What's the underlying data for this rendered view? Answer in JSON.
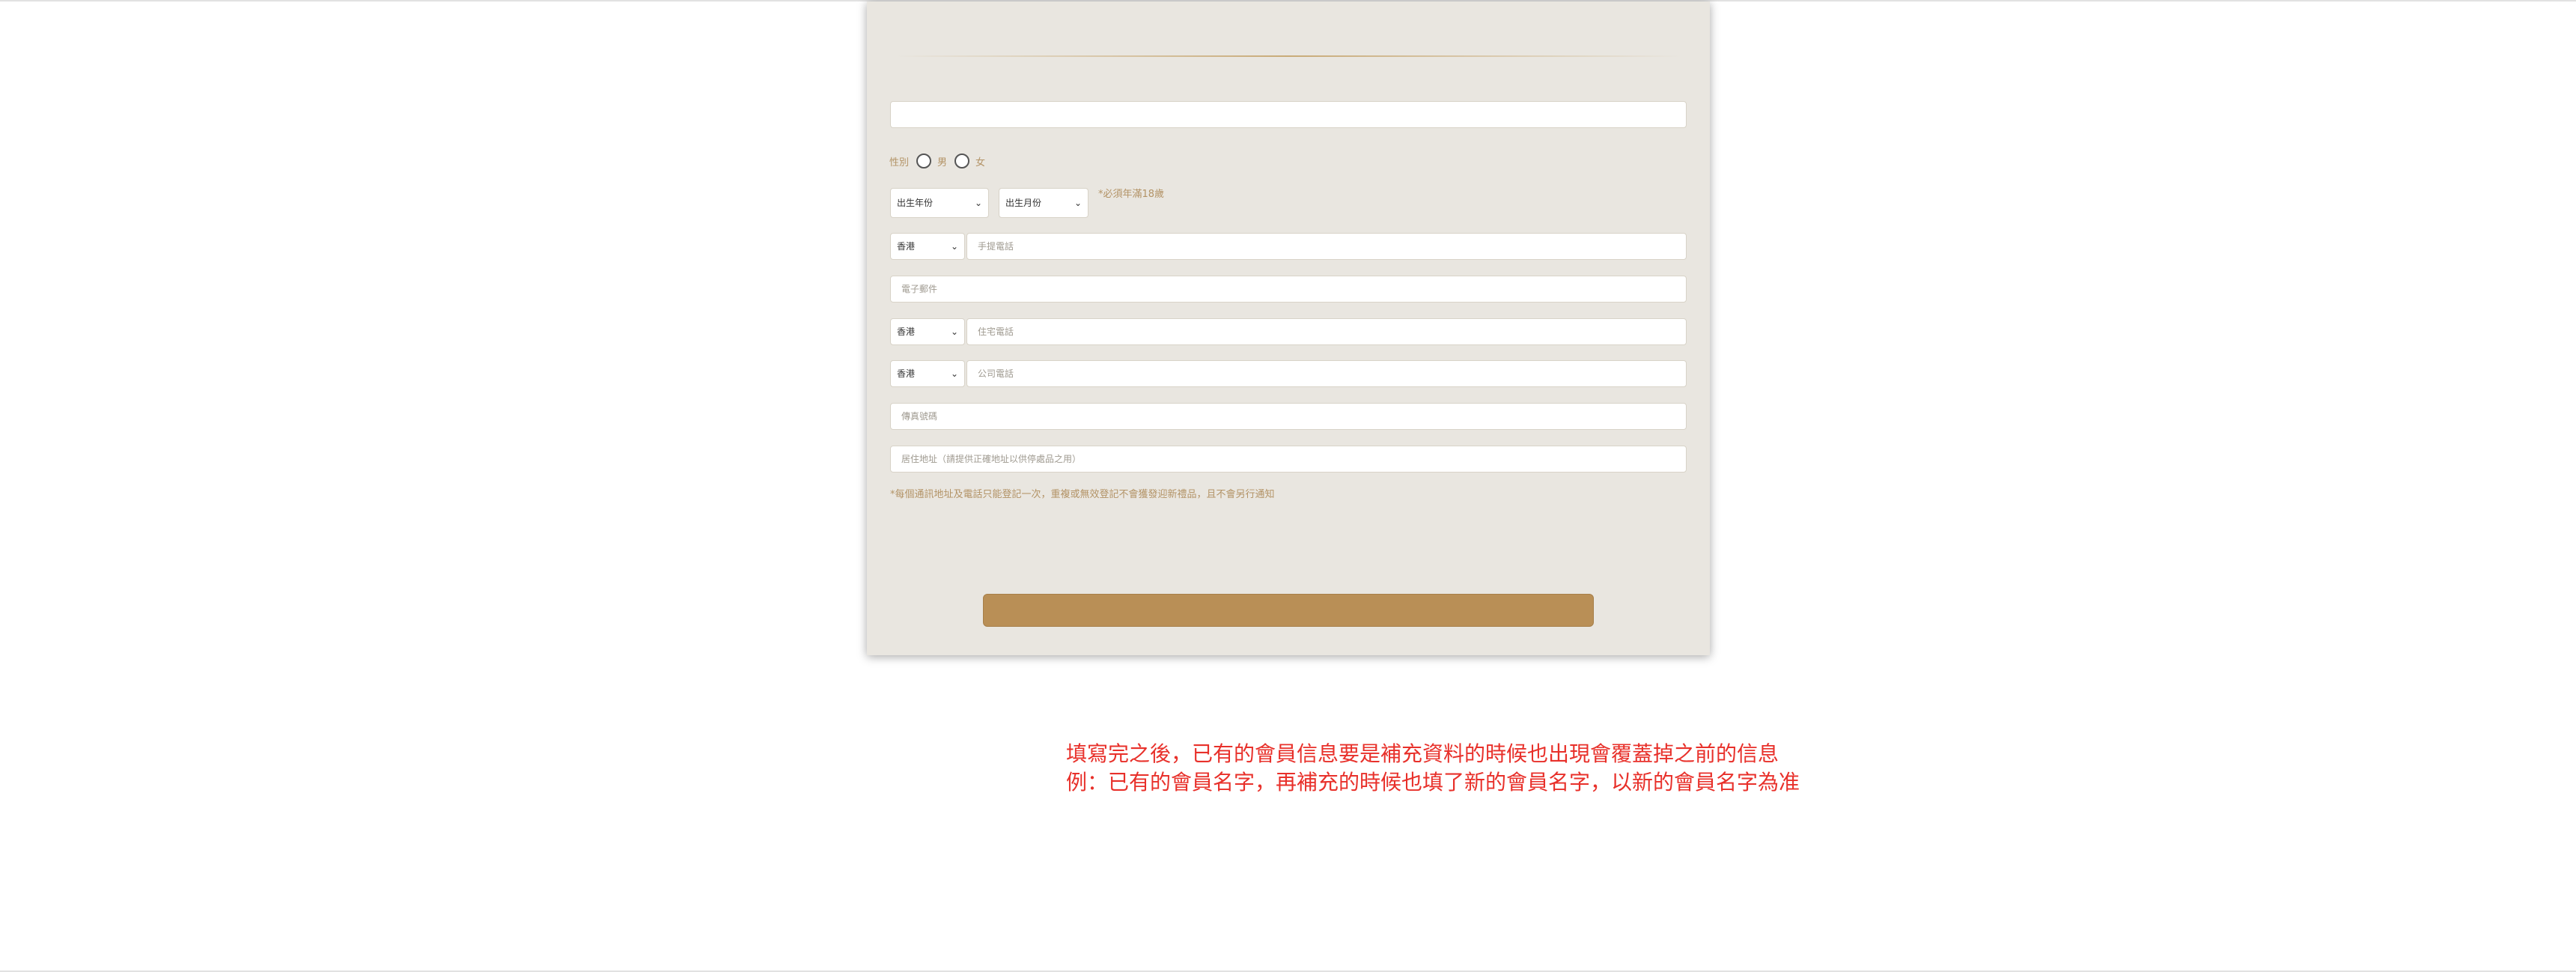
{
  "form": {
    "name_placeholder": "",
    "gender": {
      "label": "性別",
      "option_male": "男",
      "option_female": "女"
    },
    "birth_year_select": "出生年份",
    "birth_month_select": "出生月份",
    "age_note": "*必須年滿18歲",
    "mobile": {
      "region": "香港",
      "placeholder": "手提電話"
    },
    "email_placeholder": "電子郵件",
    "home_phone": {
      "region": "香港",
      "placeholder": "住宅電話"
    },
    "office_phone": {
      "region": "香港",
      "placeholder": "公司電話"
    },
    "fax_placeholder": "傳真號碼",
    "address_placeholder": "居住地址（請提供正確地址以供停處品之用）",
    "footnote": "*每個通訊地址及電話只能登記一次，重複或無效登記不會獲發迎新禮品，且不會另行通知",
    "submit_label": ""
  },
  "annotation": {
    "line1": "填寫完之後，已有的會員信息要是補充資料的時候也出現會覆蓋掉之前的信息",
    "line2": "例：已有的會員名字，再補充的時候也填了新的會員名字，以新的會員名字為准"
  },
  "colors": {
    "card_bg": "#e9e6e0",
    "accent_gold": "#b98f56",
    "label_gold": "#b39366",
    "annotation_red": "#e8302a"
  }
}
